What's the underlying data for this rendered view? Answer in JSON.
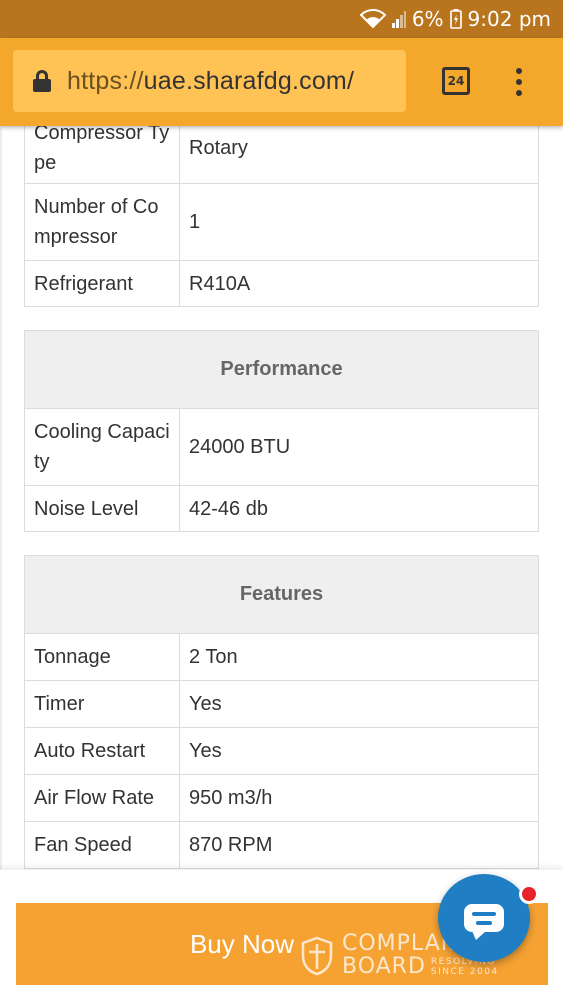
{
  "status_bar": {
    "battery": "6%",
    "time": "9:02 pm"
  },
  "browser": {
    "url_protocol": "https://",
    "url_host": "uae.sharafdg.com/",
    "tab_count": "24"
  },
  "spec_tables": [
    {
      "rows": [
        {
          "label": [
            "Compressor Ty",
            "pe"
          ],
          "value": "Rotary"
        },
        {
          "label": [
            "Number of Co",
            "mpressor"
          ],
          "value": "1"
        },
        {
          "label": [
            "Refrigerant"
          ],
          "value": "R410A"
        }
      ]
    },
    {
      "title": "Performance",
      "rows": [
        {
          "label": [
            "Cooling Capaci",
            "ty"
          ],
          "value": "24000 BTU"
        },
        {
          "label": [
            "Noise Level"
          ],
          "value": "42-46 db"
        }
      ]
    },
    {
      "title": "Features",
      "rows": [
        {
          "label": [
            "Tonnage"
          ],
          "value": "2 Ton"
        },
        {
          "label": [
            "Timer"
          ],
          "value": "Yes"
        },
        {
          "label": [
            "Auto Restart"
          ],
          "value": "Yes"
        },
        {
          "label": [
            "Air Flow Rate"
          ],
          "value": "950 m3/h"
        },
        {
          "label": [
            "Fan Speed"
          ],
          "value": "870 RPM"
        }
      ]
    }
  ],
  "buy_button": {
    "label": "Buy Now"
  },
  "watermark": {
    "line1": "COMPLAINTS",
    "line2": "BOARD",
    "tag1": "RESOLVING",
    "tag2": "SINCE 2004"
  },
  "icons": {
    "lock": "lock-icon",
    "tabs": "tab-switcher-icon",
    "menu": "overflow-menu-icon",
    "chat": "chat-icon"
  },
  "colors": {
    "status_bar": "#b8751d",
    "toolbar": "#f3a82c",
    "url_box": "#ffc255",
    "buy_button": "#f5a233",
    "chat_fab": "#1f7ec4",
    "badge": "#e8222b"
  }
}
